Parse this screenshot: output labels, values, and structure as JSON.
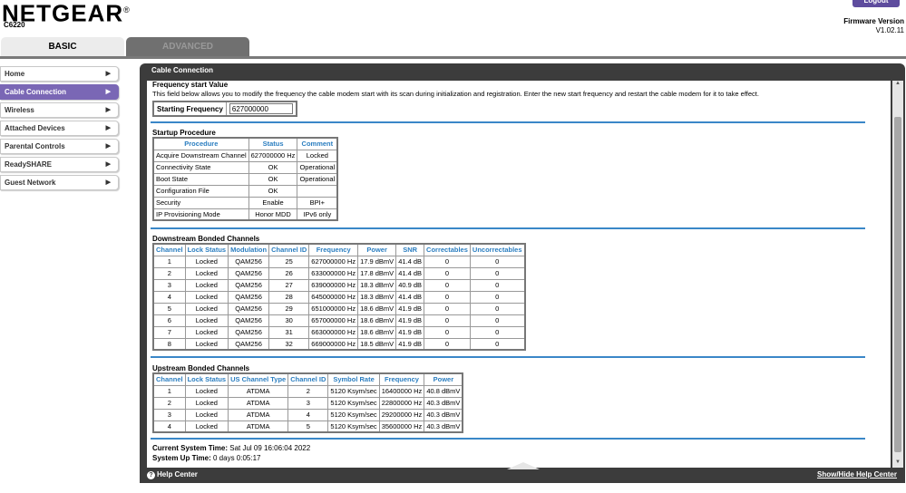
{
  "header": {
    "brand": "NETGEAR",
    "model": "C6220",
    "logout_label": "Logout",
    "firmware_label": "Firmware Version",
    "firmware_value": "V1.02.11",
    "tabs": [
      {
        "label": "BASIC"
      },
      {
        "label": "ADVANCED"
      }
    ]
  },
  "sidebar": {
    "items": [
      {
        "label": "Home"
      },
      {
        "label": "Cable Connection"
      },
      {
        "label": "Wireless"
      },
      {
        "label": "Attached Devices"
      },
      {
        "label": "Parental Controls"
      },
      {
        "label": "ReadySHARE"
      },
      {
        "label": "Guest Network"
      }
    ],
    "active_index": 1,
    "chevron": "▶"
  },
  "panel": {
    "title": "Cable Connection"
  },
  "frequency": {
    "title": "Frequency start Value",
    "description": "This field below allows you to modify the frequency the cable modem start with its scan during initialization and registration. Enter the new start frequency and restart the cable modem for it to take effect.",
    "label": "Starting Frequency",
    "value": "627000000"
  },
  "startup": {
    "title": "Startup Procedure",
    "headers": [
      "Procedure",
      "Status",
      "Comment"
    ],
    "rows": [
      [
        "Acquire Downstream Channel",
        "627000000 Hz",
        "Locked"
      ],
      [
        "Connectivity State",
        "OK",
        "Operational"
      ],
      [
        "Boot State",
        "OK",
        "Operational"
      ],
      [
        "Configuration File",
        "OK",
        ""
      ],
      [
        "Security",
        "Enable",
        "BPI+"
      ],
      [
        "IP Provisioning Mode",
        "Honor MDD",
        "IPv6 only"
      ]
    ]
  },
  "downstream": {
    "title": "Downstream Bonded Channels",
    "headers": [
      "Channel",
      "Lock Status",
      "Modulation",
      "Channel ID",
      "Frequency",
      "Power",
      "SNR",
      "Correctables",
      "Uncorrectables"
    ],
    "rows": [
      [
        "1",
        "Locked",
        "QAM256",
        "25",
        "627000000 Hz",
        "17.9 dBmV",
        "41.4 dB",
        "0",
        "0"
      ],
      [
        "2",
        "Locked",
        "QAM256",
        "26",
        "633000000 Hz",
        "17.8 dBmV",
        "41.4 dB",
        "0",
        "0"
      ],
      [
        "3",
        "Locked",
        "QAM256",
        "27",
        "639000000 Hz",
        "18.3 dBmV",
        "40.9 dB",
        "0",
        "0"
      ],
      [
        "4",
        "Locked",
        "QAM256",
        "28",
        "645000000 Hz",
        "18.3 dBmV",
        "41.4 dB",
        "0",
        "0"
      ],
      [
        "5",
        "Locked",
        "QAM256",
        "29",
        "651000000 Hz",
        "18.6 dBmV",
        "41.9 dB",
        "0",
        "0"
      ],
      [
        "6",
        "Locked",
        "QAM256",
        "30",
        "657000000 Hz",
        "18.6 dBmV",
        "41.9 dB",
        "0",
        "0"
      ],
      [
        "7",
        "Locked",
        "QAM256",
        "31",
        "663000000 Hz",
        "18.6 dBmV",
        "41.9 dB",
        "0",
        "0"
      ],
      [
        "8",
        "Locked",
        "QAM256",
        "32",
        "669000000 Hz",
        "18.5 dBmV",
        "41.9 dB",
        "0",
        "0"
      ]
    ]
  },
  "upstream": {
    "title": "Upstream Bonded Channels",
    "headers": [
      "Channel",
      "Lock Status",
      "US Channel Type",
      "Channel ID",
      "Symbol Rate",
      "Frequency",
      "Power"
    ],
    "rows": [
      [
        "1",
        "Locked",
        "ATDMA",
        "2",
        "5120 Ksym/sec",
        "16400000 Hz",
        "40.8 dBmV"
      ],
      [
        "2",
        "Locked",
        "ATDMA",
        "3",
        "5120 Ksym/sec",
        "22800000 Hz",
        "40.3 dBmV"
      ],
      [
        "3",
        "Locked",
        "ATDMA",
        "4",
        "5120 Ksym/sec",
        "29200000 Hz",
        "40.3 dBmV"
      ],
      [
        "4",
        "Locked",
        "ATDMA",
        "5",
        "5120 Ksym/sec",
        "35600000 Hz",
        "40.3 dBmV"
      ]
    ]
  },
  "system": {
    "time_label": "Current System Time:",
    "time_value": "Sat Jul 09 16:06:04 2022",
    "uptime_label": "System Up Time:",
    "uptime_value": "0 days 0:05:17"
  },
  "footer": {
    "help_label": "Help Center",
    "show_hide_label": "Show/Hide Help Center"
  },
  "colors": {
    "accent_purple": "#7a67b5",
    "header_blue": "#2b7ec0",
    "panel_dark": "#3c3c3c"
  }
}
